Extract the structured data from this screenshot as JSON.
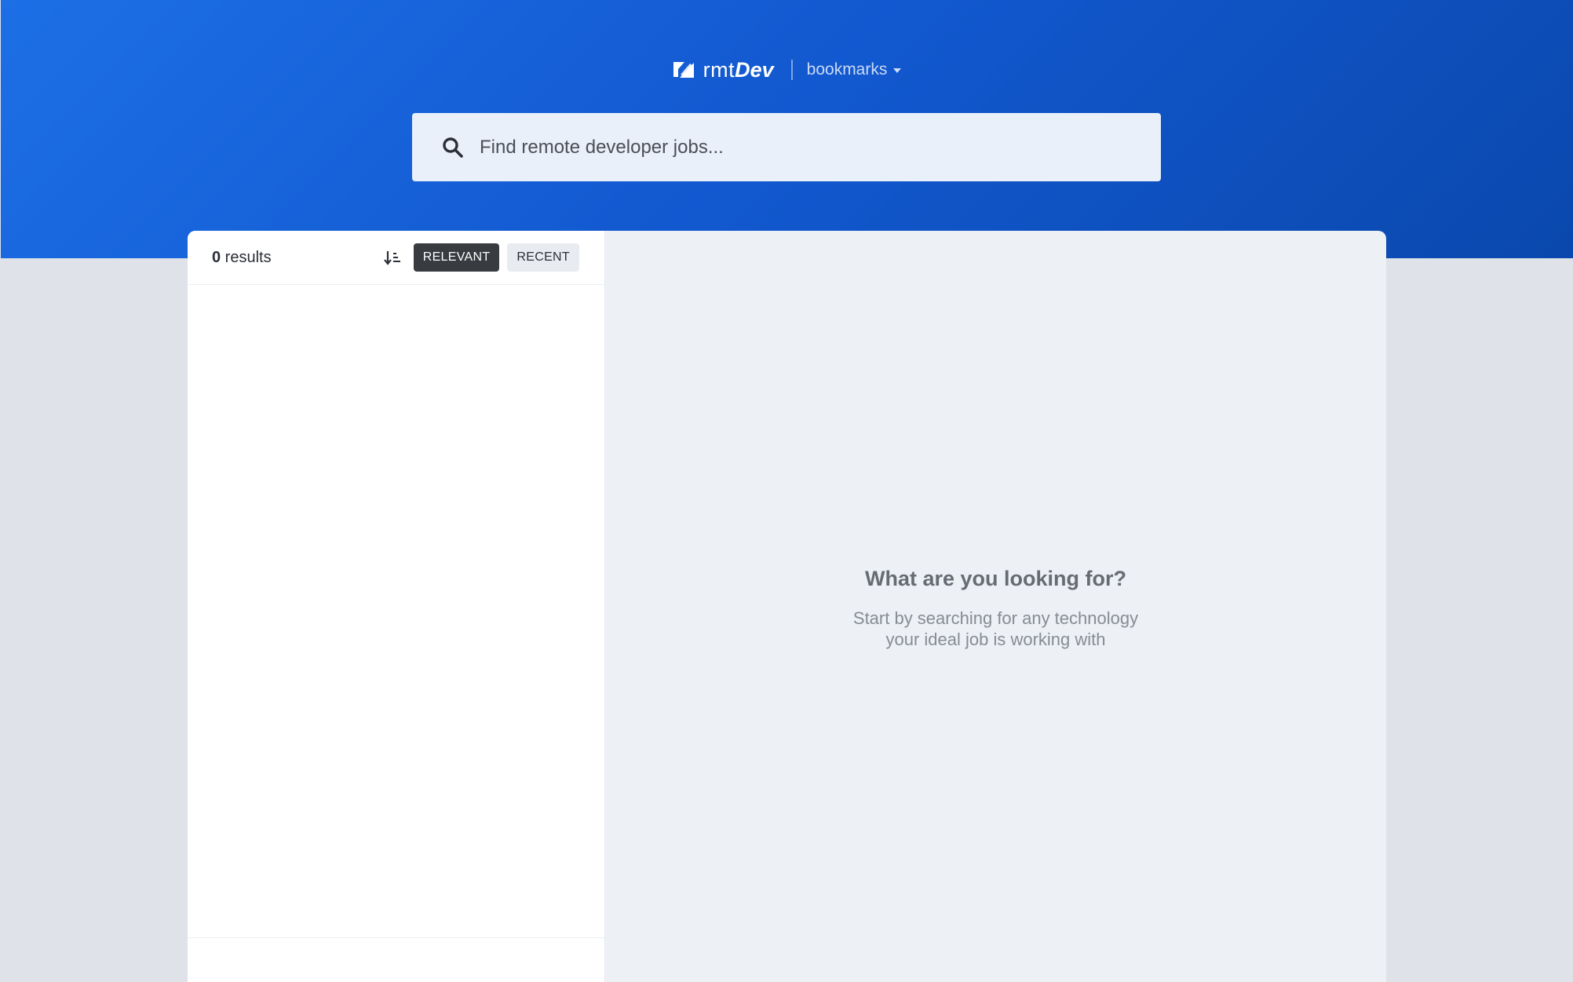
{
  "header": {
    "logo_text_light": "rmt",
    "logo_text_bold": "Dev",
    "bookmarks_label": "bookmarks",
    "logo_icon": "pen-square-icon",
    "caret_icon": "caret-down-icon"
  },
  "search": {
    "placeholder": "Find remote developer jobs...",
    "value": "",
    "icon": "search-icon"
  },
  "sidebar": {
    "results_count": "0",
    "results_label": " results",
    "sort_icon": "sort-icon",
    "sort_options": [
      {
        "label": "RELEVANT",
        "active": true
      },
      {
        "label": "RECENT",
        "active": false
      }
    ]
  },
  "empty_state": {
    "title": "What are you looking for?",
    "subtitle_line1": "Start by searching for any technology",
    "subtitle_line2": "your ideal job is working with"
  },
  "colors": {
    "header_gradient_start": "#1d6fe6",
    "header_gradient_end": "#0a48ad",
    "active_button": "#383b40",
    "page_background": "#dfe3e9"
  }
}
